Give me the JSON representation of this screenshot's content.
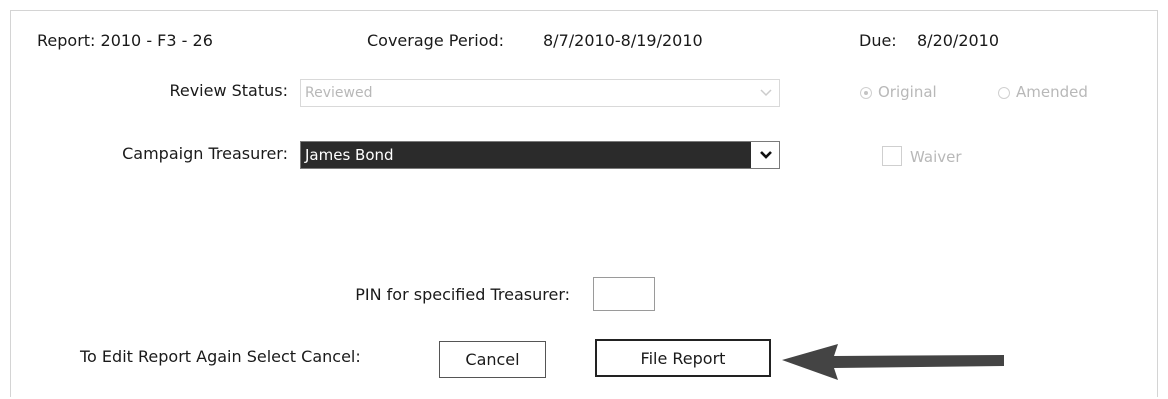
{
  "header": {
    "report": "Report: 2010 - F3 - 26",
    "coverage_label": "Coverage Period:",
    "coverage_value": "8/7/2010-8/19/2010",
    "due_label": "Due:",
    "due_value": "8/20/2010"
  },
  "review": {
    "label": "Review Status:",
    "value": "Reviewed",
    "original_label": "Original",
    "amended_label": "Amended",
    "selected": "Original"
  },
  "treasurer": {
    "label": "Campaign Treasurer:",
    "value": "James Bond",
    "waiver_label": "Waiver"
  },
  "pin": {
    "label": "PIN for specified Treasurer:",
    "value": ""
  },
  "actions": {
    "edit_prompt": "To Edit Report Again Select Cancel:",
    "cancel_label": "Cancel",
    "file_label": "File Report"
  },
  "colors": {
    "disabled_text": "#b8b8b8",
    "selection_bg": "#2b2b2b",
    "arrow": "#444444"
  }
}
